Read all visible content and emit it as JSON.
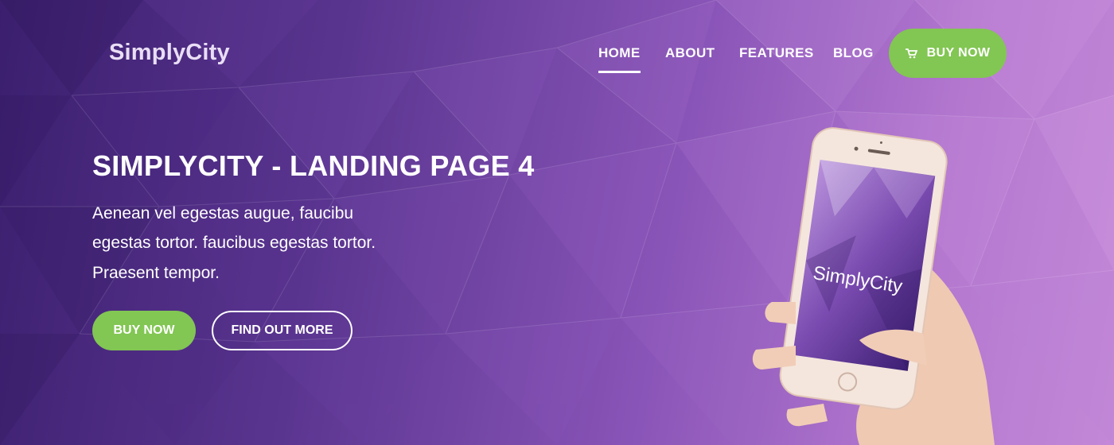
{
  "brand": {
    "logo": "SimplyCity"
  },
  "nav": {
    "items": [
      {
        "label": "HOME",
        "active": true
      },
      {
        "label": "ABOUT"
      },
      {
        "label": "FEATURES"
      },
      {
        "label": "BLOG"
      }
    ],
    "buy_label": "BUY NOW",
    "buy_icon": "cart-icon"
  },
  "hero": {
    "title": "SIMPLYCITY - LANDING PAGE 4",
    "lines": [
      "Aenean vel egestas augue, faucibu",
      "egestas tortor. faucibus egestas tortor.",
      "Praesent tempor."
    ],
    "primary_button": "BUY NOW",
    "secondary_button": "FIND OUT MORE"
  },
  "phone": {
    "screen_brand": "SimplyCity"
  },
  "colors": {
    "accent_green": "#82c653",
    "bg_dark": "#3b1f6e",
    "bg_light": "#c488d8"
  }
}
